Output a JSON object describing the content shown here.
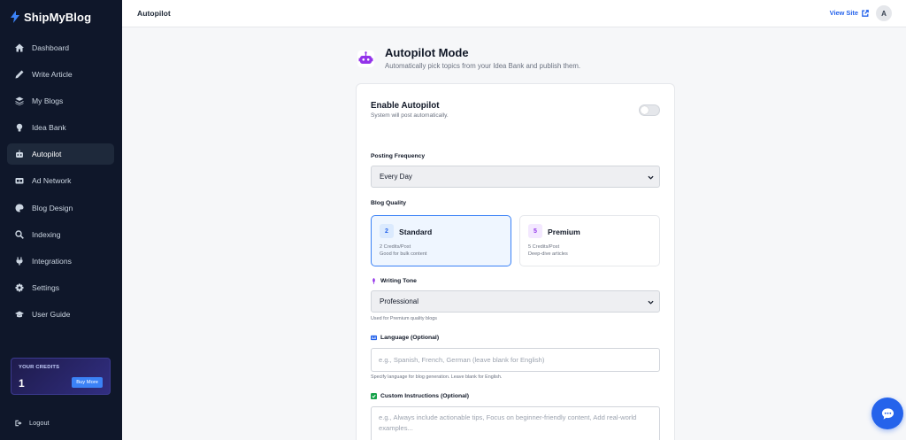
{
  "brand": {
    "name": "ShipMyBlog"
  },
  "sidebar": {
    "items": [
      {
        "label": "Dashboard",
        "icon": "home-icon"
      },
      {
        "label": "Write Article",
        "icon": "pen-icon"
      },
      {
        "label": "My Blogs",
        "icon": "layers-icon"
      },
      {
        "label": "Idea Bank",
        "icon": "lightbulb-icon"
      },
      {
        "label": "Autopilot",
        "icon": "robot-icon",
        "active": true
      },
      {
        "label": "Ad Network",
        "icon": "ad-icon"
      },
      {
        "label": "Blog Design",
        "icon": "palette-icon"
      },
      {
        "label": "Indexing",
        "icon": "search-icon"
      },
      {
        "label": "Integrations",
        "icon": "plug-icon"
      },
      {
        "label": "Settings",
        "icon": "gear-icon"
      },
      {
        "label": "User Guide",
        "icon": "graduation-cap-icon"
      }
    ],
    "credits": {
      "label": "YOUR CREDITS",
      "value": "1",
      "buy_label": "Buy More"
    },
    "logout_label": "Logout"
  },
  "topbar": {
    "title": "Autopilot",
    "view_site_label": "View Site",
    "avatar_initial": "A"
  },
  "header": {
    "title": "Autopilot Mode",
    "subtitle": "Automatically pick topics from your Idea Bank and publish them."
  },
  "form": {
    "enable": {
      "title": "Enable Autopilot",
      "subtitle": "System will post automatically.",
      "enabled": false
    },
    "frequency": {
      "label": "Posting Frequency",
      "value": "Every Day"
    },
    "quality": {
      "label": "Blog Quality",
      "options": [
        {
          "badge": "2",
          "name": "Standard",
          "credits": "2 Credits/Post",
          "desc": "Good for bulk content",
          "selected": true
        },
        {
          "badge": "5",
          "name": "Premium",
          "credits": "5 Credits/Post",
          "desc": "Deep-dive articles",
          "selected": false
        }
      ]
    },
    "tone": {
      "label": "Writing Tone",
      "value": "Professional",
      "hint": "Used for Premium quality blogs"
    },
    "language": {
      "label": "Language (Optional)",
      "placeholder": "e.g., Spanish, French, German (leave blank for English)",
      "hint": "Specify language for blog generation. Leave blank for English."
    },
    "instructions": {
      "label": "Custom Instructions (Optional)",
      "placeholder": "e.g., Always include actionable tips, Focus on beginner-friendly content, Add real-world examples..."
    }
  },
  "colors": {
    "sidebar_bg": "#0f172a",
    "accent": "#2563eb",
    "premium": "#9333ea"
  }
}
